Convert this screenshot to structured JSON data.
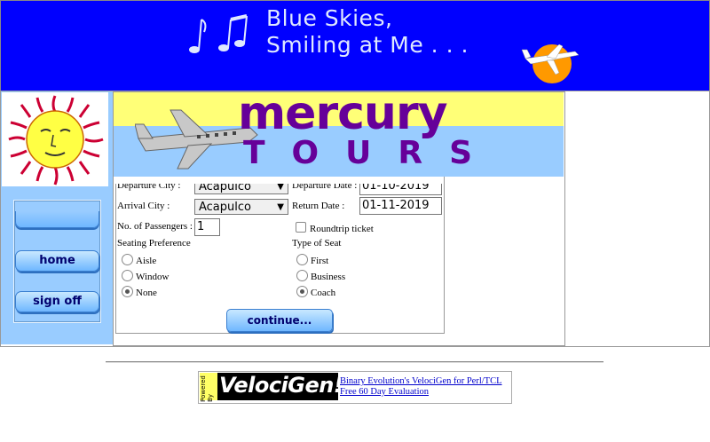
{
  "banner": {
    "line1": "Blue Skies,",
    "line2": "Smiling at Me . . .",
    "icons": [
      "music-notes-icon",
      "sun-airplane-icon"
    ]
  },
  "logo": {
    "word1": "mercury",
    "word2": "TOURS"
  },
  "nav": {
    "home_label": "home",
    "signoff_label": "sign off"
  },
  "form": {
    "departure_city_label": "Departure City :",
    "departure_city_value": "Acapulco",
    "departure_date_label": "Departure Date :",
    "departure_date_value": "01-10-2019",
    "arrival_city_label": "Arrival City :",
    "arrival_city_value": "Acapulco",
    "return_date_label": "Return Date :",
    "return_date_value": "01-11-2019",
    "passengers_label": "No. of Passengers :",
    "passengers_value": "1",
    "roundtrip_label": "Roundtrip ticket",
    "roundtrip_checked": false,
    "seating_pref_label": "Seating Preference",
    "seating_options": [
      {
        "label": "Aisle",
        "selected": false
      },
      {
        "label": "Window",
        "selected": false
      },
      {
        "label": "None",
        "selected": true
      }
    ],
    "seat_type_label": "Type of Seat",
    "seat_type_options": [
      {
        "label": "First",
        "selected": false
      },
      {
        "label": "Business",
        "selected": false
      },
      {
        "label": "Coach",
        "selected": true
      }
    ],
    "continue_label": "continue..."
  },
  "footer": {
    "powered_by": "Powered By",
    "logo_text": "VelociGen!",
    "link1": "Binary Evolution's VelociGen for Perl/TCL",
    "link2": "Free 60 Day Evaluation"
  },
  "colors": {
    "banner_bg": "#0000ff",
    "sidebar_bg": "#99ccff",
    "logo_text": "#660099",
    "link": "#0000cc"
  }
}
